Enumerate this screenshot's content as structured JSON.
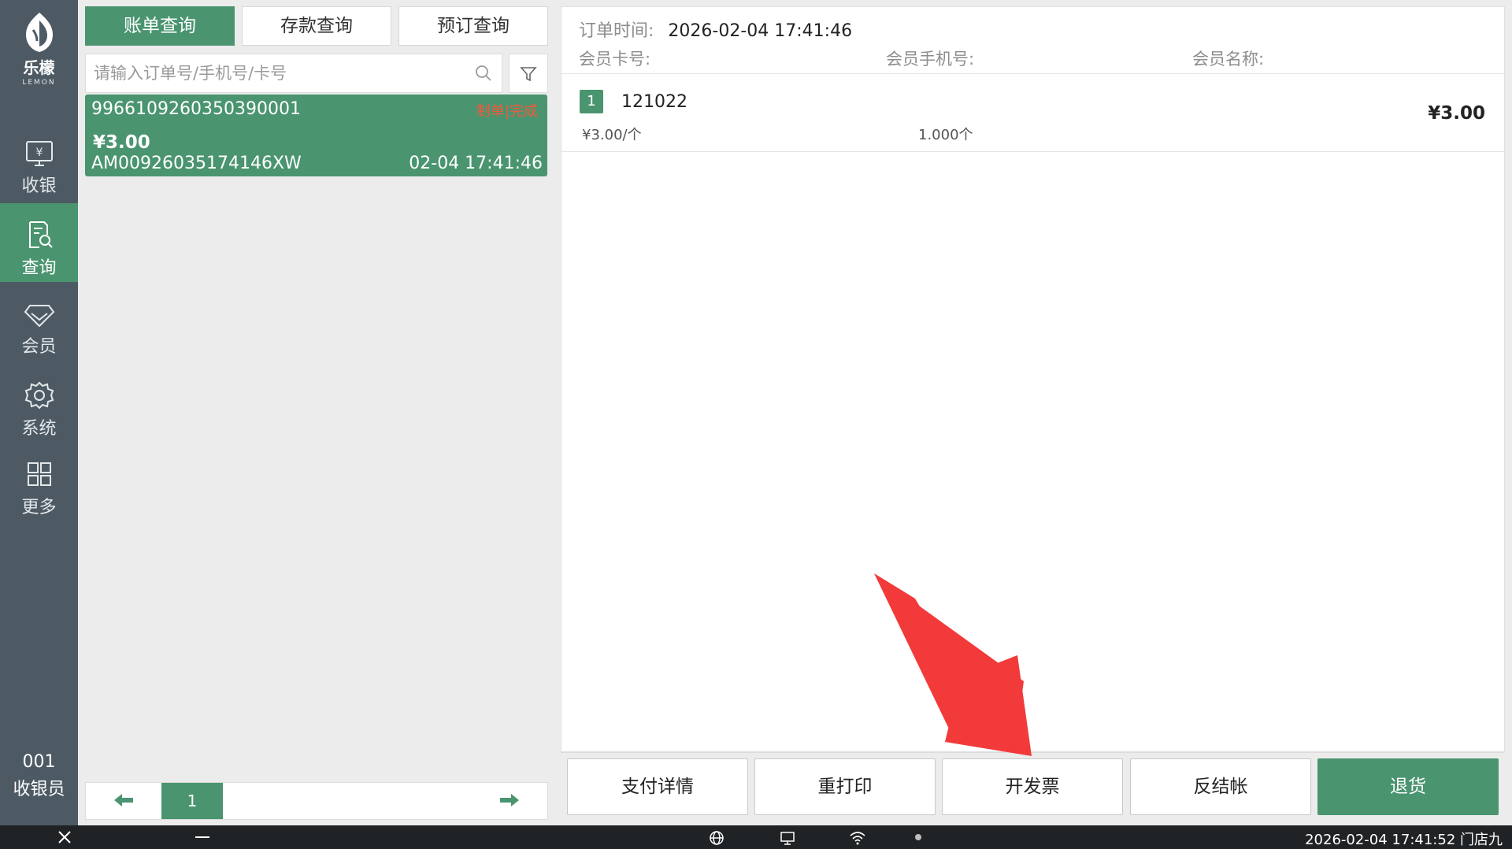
{
  "sidebar": {
    "brand_cn": "乐檬",
    "brand_en": "LEMON",
    "items": [
      {
        "label": "收银"
      },
      {
        "label": "查询"
      },
      {
        "label": "会员"
      },
      {
        "label": "系统"
      },
      {
        "label": "更多"
      }
    ],
    "cashier_no": "001",
    "cashier_role": "收银员"
  },
  "tabs": [
    {
      "label": "账单查询"
    },
    {
      "label": "存款查询"
    },
    {
      "label": "预订查询"
    }
  ],
  "search": {
    "placeholder": "请输入订单号/手机号/卡号",
    "value": ""
  },
  "orders": [
    {
      "order_no": "9966109260350390001",
      "status": "制单|完成",
      "amount": "¥3.00",
      "serial": "AM00926035174146XW",
      "time": "02-04 17:41:46"
    }
  ],
  "pager": {
    "page": "1"
  },
  "detail": {
    "order_time_label": "订单时间:",
    "order_time": "2026-02-04 17:41:46",
    "member_card_label": "会员卡号:",
    "member_phone_label": "会员手机号:",
    "member_name_label": "会员名称:",
    "items": [
      {
        "index": "1",
        "code": "121022",
        "unit_price": "¥3.00/个",
        "qty": "1.000个",
        "total": "¥3.00"
      }
    ]
  },
  "actions": {
    "pay_detail": "支付详情",
    "reprint": "重打印",
    "invoice": "开发票",
    "reverse": "反结帐",
    "refund": "退货"
  },
  "taskbar": {
    "clock": "2026-02-04 17:41:52 门店九"
  },
  "colors": {
    "primary_green": "#4a9470",
    "sidebar_bg": "#4d5a64",
    "status_red": "#f05a3c",
    "annotation_red": "#f23a3a"
  }
}
